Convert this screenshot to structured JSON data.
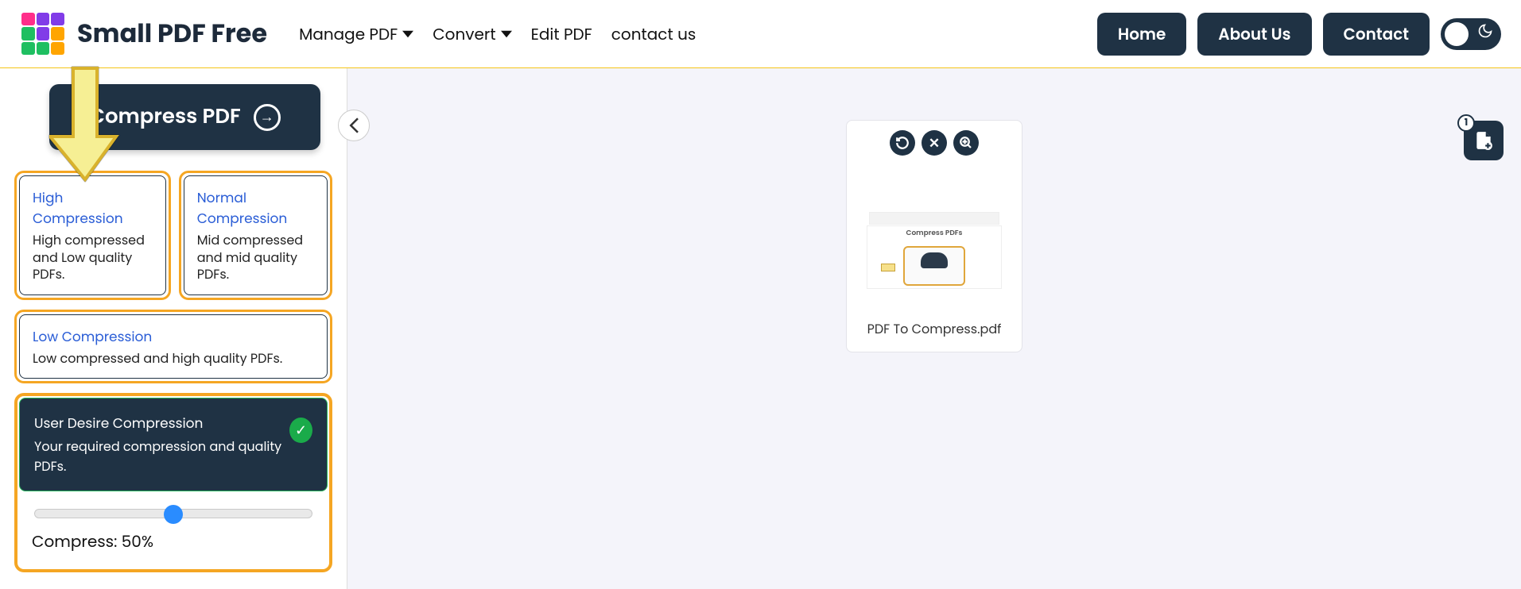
{
  "brand": {
    "name": "Small PDF Free"
  },
  "nav": {
    "items": [
      {
        "label": "Manage PDF",
        "dropdown": true
      },
      {
        "label": "Convert",
        "dropdown": true
      },
      {
        "label": "Edit PDF",
        "dropdown": false
      },
      {
        "label": "contact us",
        "dropdown": false
      }
    ]
  },
  "header_buttons": {
    "home": "Home",
    "about": "About Us",
    "contact": "Contact"
  },
  "sidebar": {
    "primary_action": "Compress PDF",
    "options": {
      "high": {
        "title": "High Compression",
        "desc": "High compressed and Low quality PDFs."
      },
      "normal": {
        "title": "Normal Compression",
        "desc": "Mid compressed and mid quality PDFs."
      },
      "low": {
        "title": "Low Compression",
        "desc": "Low compressed and high quality PDFs."
      },
      "user": {
        "title": "User Desire Compression",
        "desc": "Your required compression and quality PDFs."
      }
    },
    "slider": {
      "label": "Compress: 50%",
      "value": 50
    }
  },
  "workspace": {
    "file_name": "PDF To Compress.pdf",
    "thumb_caption": "Compress PDFs",
    "file_count": "1"
  },
  "icons": {
    "rotate": "rotate-icon",
    "close": "close-icon",
    "zoom": "zoom-in-icon",
    "add_file": "add-file-icon",
    "chevron": "chevron-down-icon",
    "moon": "moon-icon"
  }
}
